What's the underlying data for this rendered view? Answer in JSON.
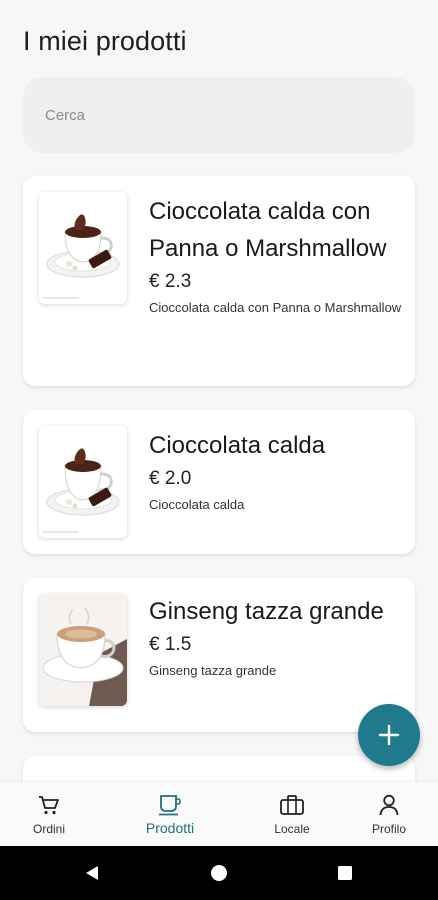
{
  "header": {
    "title": "I miei prodotti"
  },
  "search": {
    "placeholder": "Cerca"
  },
  "products": [
    {
      "name": "Cioccolata calda con Panna o Marshmallow",
      "price": "€ 2.3",
      "description": "Cioccolata calda con Panna o Marshmallow",
      "image_icon": "hot-chocolate-image"
    },
    {
      "name": "Cioccolata calda",
      "price": "€ 2.0",
      "description": "Cioccolata calda",
      "image_icon": "hot-chocolate-image"
    },
    {
      "name": "Ginseng tazza grande",
      "price": "€ 1.5",
      "description": "Ginseng tazza grande",
      "image_icon": "ginseng-cup-image"
    }
  ],
  "fab": {
    "icon": "plus-icon",
    "color": "#1f7a8c"
  },
  "bottom_nav": {
    "items": [
      {
        "label": "Ordini",
        "icon": "cart-icon",
        "active": false
      },
      {
        "label": "Prodotti",
        "icon": "cup-icon",
        "active": true
      },
      {
        "label": "Locale",
        "icon": "briefcase-icon",
        "active": false
      },
      {
        "label": "Profilo",
        "icon": "person-icon",
        "active": false
      }
    ],
    "active_color": "#1f6f80"
  },
  "system_nav": {
    "buttons": [
      "back-icon",
      "home-icon",
      "recents-icon"
    ]
  }
}
